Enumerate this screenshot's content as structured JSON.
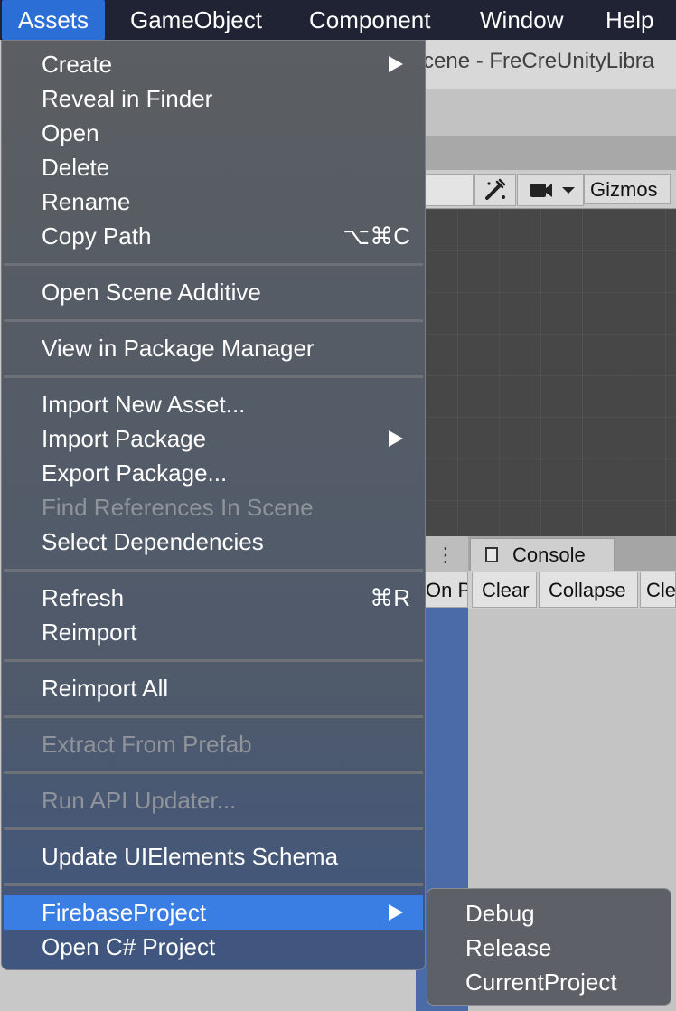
{
  "menubar": {
    "items": [
      {
        "label": "Assets",
        "active": true
      },
      {
        "label": "GameObject"
      },
      {
        "label": "Component"
      },
      {
        "label": "Window"
      },
      {
        "label": "Help"
      }
    ]
  },
  "background": {
    "window_title": "cene - FreCreUnityLibra",
    "scene_toolbar": {
      "gizmos_label": "Gizmos",
      "tools_icon": "tools-icon",
      "camera_icon": "camera-icon",
      "dropdown_icon": "chevron-down-icon"
    },
    "project_panel": {
      "menu_icon": "kebab-icon",
      "button_label": "On P"
    },
    "console": {
      "tab_label": "Console",
      "icon": "console-icon",
      "buttons": {
        "clear": "Clear",
        "collapse": "Collapse",
        "clear_on_build": "Cle"
      }
    }
  },
  "assets_menu": {
    "items": [
      {
        "label": "Create",
        "submenu": true
      },
      {
        "label": "Reveal in Finder"
      },
      {
        "label": "Open"
      },
      {
        "label": "Delete"
      },
      {
        "label": "Rename"
      },
      {
        "label": "Copy Path",
        "shortcut": "⌥⌘C"
      },
      {
        "label": "Open Scene Additive"
      },
      {
        "label": "View in Package Manager"
      },
      {
        "label": "Import New Asset..."
      },
      {
        "label": "Import Package",
        "submenu": true
      },
      {
        "label": "Export Package..."
      },
      {
        "label": "Find References In Scene",
        "disabled": true
      },
      {
        "label": "Select Dependencies"
      },
      {
        "label": "Refresh",
        "shortcut": "⌘R"
      },
      {
        "label": "Reimport"
      },
      {
        "label": "Reimport All"
      },
      {
        "label": "Extract From Prefab",
        "disabled": true
      },
      {
        "label": "Run API Updater...",
        "disabled": true
      },
      {
        "label": "Update UIElements Schema"
      },
      {
        "label": "FirebaseProject",
        "submenu": true,
        "highlighted": true
      },
      {
        "label": "Open C# Project"
      }
    ]
  },
  "firebase_submenu": {
    "items": [
      {
        "label": "Debug"
      },
      {
        "label": "Release"
      },
      {
        "label": "CurrentProject"
      }
    ]
  },
  "colors": {
    "menubar_bg": "#1f2333",
    "highlight": "#3b7ee3",
    "menu_bg": "#5b5e62",
    "disabled_text": "#8f939a"
  }
}
